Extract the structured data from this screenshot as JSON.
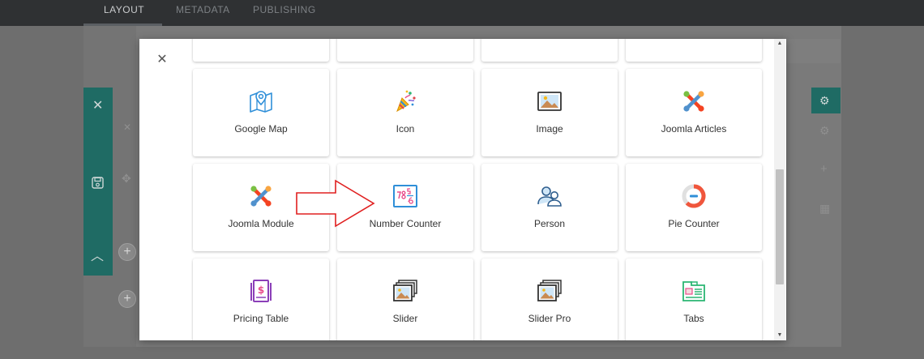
{
  "top_tabs": [
    {
      "label": "LAYOUT",
      "active": true
    },
    {
      "label": "METADATA",
      "active": false
    },
    {
      "label": "PUBLISHING",
      "active": false
    }
  ],
  "modal": {
    "addons": [
      {
        "label": "Google Map",
        "icon": "map-pin-icon"
      },
      {
        "label": "Icon",
        "icon": "party-popper-icon"
      },
      {
        "label": "Image",
        "icon": "image-icon"
      },
      {
        "label": "Joomla Articles",
        "icon": "joomla-icon"
      },
      {
        "label": "Joomla Module",
        "icon": "joomla-icon"
      },
      {
        "label": "Number Counter",
        "icon": "number-counter-icon"
      },
      {
        "label": "Person",
        "icon": "person-icon"
      },
      {
        "label": "Pie Counter",
        "icon": "pie-counter-icon"
      },
      {
        "label": "Pricing Table",
        "icon": "pricing-table-icon"
      },
      {
        "label": "Slider",
        "icon": "slider-icon"
      },
      {
        "label": "Slider Pro",
        "icon": "slider-pro-icon"
      },
      {
        "label": "Tabs",
        "icon": "tabs-icon"
      }
    ]
  },
  "colors": {
    "accent_blue": "#2f8fd8",
    "teal": "#1f6b64",
    "arrow_red": "#e02020"
  }
}
